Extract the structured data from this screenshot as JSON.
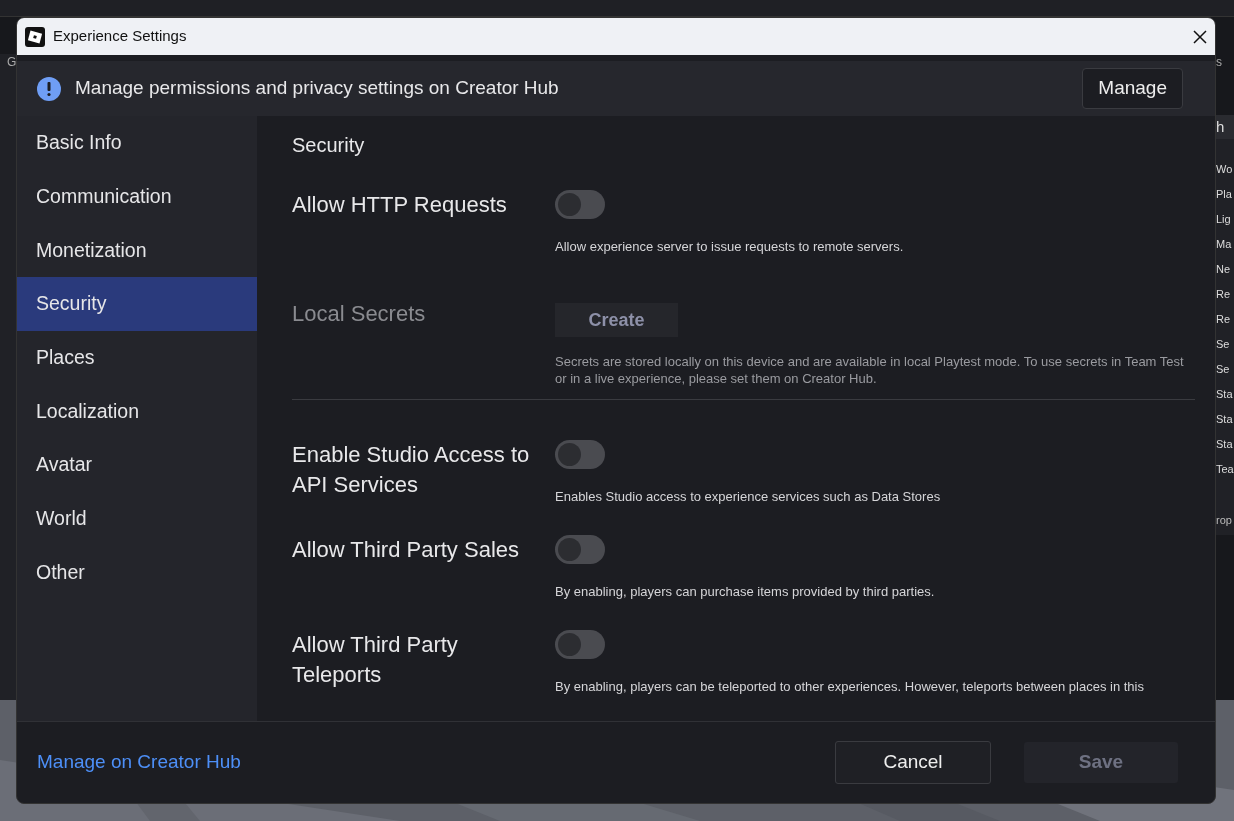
{
  "background": {
    "left_label": "G",
    "right_label": "s",
    "panel_header": "h",
    "panel_items": [
      "Wo",
      "Pla",
      "Lig",
      "Ma",
      "Ne",
      "Re",
      "Re",
      "Se",
      "Se",
      "Sta",
      "Sta",
      "Sta",
      "Tea"
    ],
    "panel_footer": "rop"
  },
  "window": {
    "title": "Experience Settings"
  },
  "banner": {
    "text": "Manage permissions and privacy settings on Creator Hub",
    "button": "Manage"
  },
  "sidebar": {
    "items": [
      {
        "label": "Basic Info",
        "selected": false
      },
      {
        "label": "Communication",
        "selected": false
      },
      {
        "label": "Monetization",
        "selected": false
      },
      {
        "label": "Security",
        "selected": true
      },
      {
        "label": "Places",
        "selected": false
      },
      {
        "label": "Localization",
        "selected": false
      },
      {
        "label": "Avatar",
        "selected": false
      },
      {
        "label": "World",
        "selected": false
      },
      {
        "label": "Other",
        "selected": false
      }
    ]
  },
  "section_title": "Security",
  "settings": [
    {
      "kind": "toggle",
      "label": "Allow HTTP Requests",
      "on": false,
      "disabled": false,
      "description": "Allow experience server to issue requests to remote servers."
    },
    {
      "kind": "button",
      "label": "Local Secrets",
      "button": "Create",
      "disabled": true,
      "description": "Secrets are stored locally on this device and are available in local Playtest mode. To use secrets in Team Test or in a live experience, please set them on Creator Hub."
    },
    {
      "kind": "toggle",
      "label": "Enable Studio Access to API Services",
      "on": false,
      "disabled": false,
      "description": "Enables Studio access to experience services such as Data Stores"
    },
    {
      "kind": "toggle",
      "label": "Allow Third Party Sales",
      "on": false,
      "disabled": false,
      "description": "By enabling, players can purchase items provided by third parties."
    },
    {
      "kind": "toggle",
      "label": "Allow Third Party Teleports",
      "on": false,
      "disabled": false,
      "description": "By enabling, players can be teleported to other experiences. However, teleports between places in this"
    }
  ],
  "footer": {
    "link": "Manage on Creator Hub",
    "cancel": "Cancel",
    "save": "Save",
    "save_disabled": true
  }
}
